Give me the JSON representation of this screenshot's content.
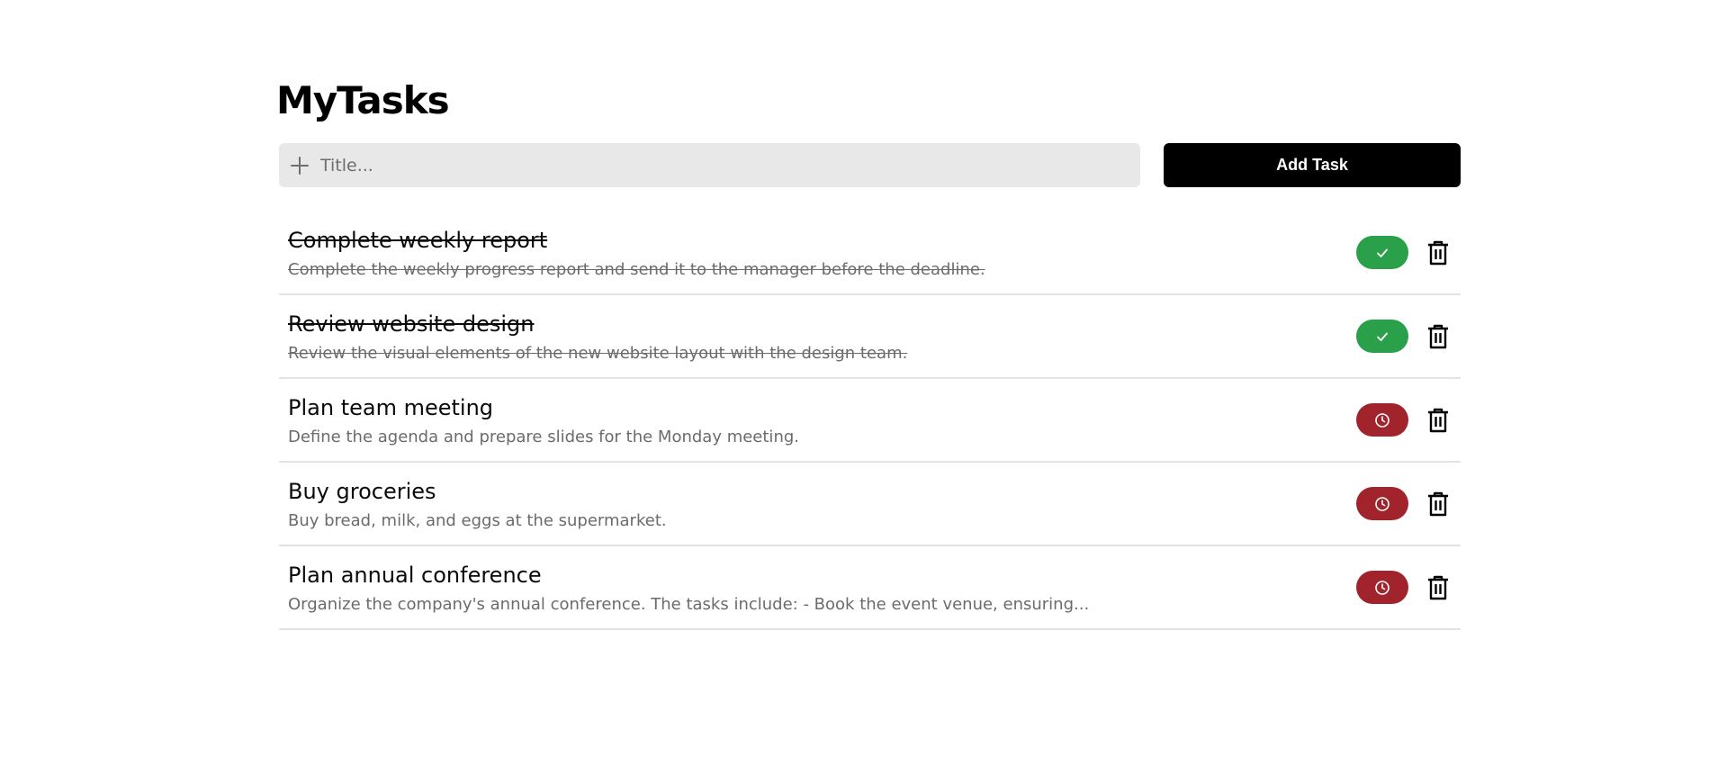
{
  "app": {
    "title": "MyTasks"
  },
  "add_form": {
    "placeholder": "Title...",
    "button_label": "Add Task",
    "icon": "plus-icon"
  },
  "colors": {
    "complete": "#2ba04a",
    "pending": "#a1242c",
    "primary_button": "#000000"
  },
  "tasks": [
    {
      "title": "Complete weekly report",
      "description": "Complete the weekly progress report and send it to the manager before the deadline.",
      "status": "completed",
      "status_icon": "check-icon"
    },
    {
      "title": "Review website design",
      "description": "Review the visual elements of the new website layout with the design team.",
      "status": "completed",
      "status_icon": "check-icon"
    },
    {
      "title": "Plan team meeting",
      "description": "Define the agenda and prepare slides for the Monday meeting.",
      "status": "pending",
      "status_icon": "clock-icon"
    },
    {
      "title": "Buy groceries",
      "description": "Buy bread, milk, and eggs at the supermarket.",
      "status": "pending",
      "status_icon": "clock-icon"
    },
    {
      "title": "Plan annual conference",
      "description": "Organize the company's annual conference. The tasks include: - Book the event venue, ensuring...",
      "status": "pending",
      "status_icon": "clock-icon"
    }
  ]
}
